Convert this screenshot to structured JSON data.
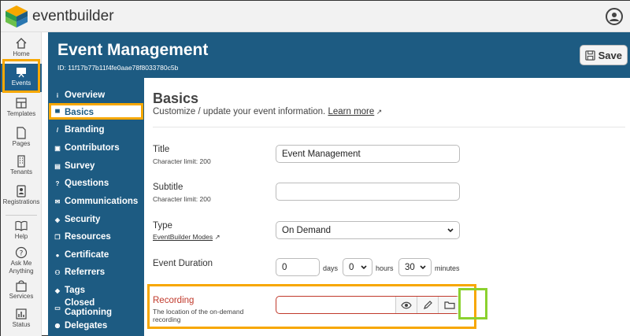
{
  "app": {
    "brand": "eventbuilder"
  },
  "rail": {
    "items": [
      {
        "label": "Home"
      },
      {
        "label": "Events"
      },
      {
        "label": "Templates"
      },
      {
        "label": "Pages"
      },
      {
        "label": "Tenants"
      },
      {
        "label": "Registrations"
      },
      {
        "label": "Help"
      },
      {
        "label": "Ask Me Anything"
      },
      {
        "label": "Services"
      },
      {
        "label": "Status"
      }
    ]
  },
  "header": {
    "title": "Event Management",
    "id_text": "ID: 11f17b77b11f4fe0aae78f8033780c5b",
    "save_label": "Save"
  },
  "sidenav": {
    "items": [
      {
        "label": "Overview"
      },
      {
        "label": "Basics"
      },
      {
        "label": "Branding"
      },
      {
        "label": "Contributors"
      },
      {
        "label": "Survey"
      },
      {
        "label": "Questions"
      },
      {
        "label": "Communications"
      },
      {
        "label": "Security"
      },
      {
        "label": "Resources"
      },
      {
        "label": "Certificate"
      },
      {
        "label": "Referrers"
      },
      {
        "label": "Tags"
      },
      {
        "label": "Closed Captioning"
      },
      {
        "label": "Delegates"
      }
    ]
  },
  "main": {
    "heading": "Basics",
    "description": "Customize / update your event information.",
    "learn_more": "Learn more",
    "fields": {
      "title": {
        "label": "Title",
        "sub": "Character limit: 200",
        "value": "Event Management"
      },
      "subtitle": {
        "label": "Subtitle",
        "sub": "Character limit: 200",
        "value": ""
      },
      "type": {
        "label": "Type",
        "link": "EventBuilder Modes",
        "value": "On Demand"
      },
      "duration": {
        "label": "Event Duration",
        "days": "0",
        "days_unit": "days",
        "hours": "0",
        "hours_unit": "hours",
        "minutes": "30",
        "minutes_unit": "minutes"
      },
      "recording": {
        "label": "Recording",
        "sub": "The location of the on-demand recording",
        "value": ""
      }
    }
  },
  "colors": {
    "primary": "#1d5b82",
    "highlight": "#f7a700",
    "green_highlight": "#8bd12f",
    "error": "#c0392b"
  }
}
